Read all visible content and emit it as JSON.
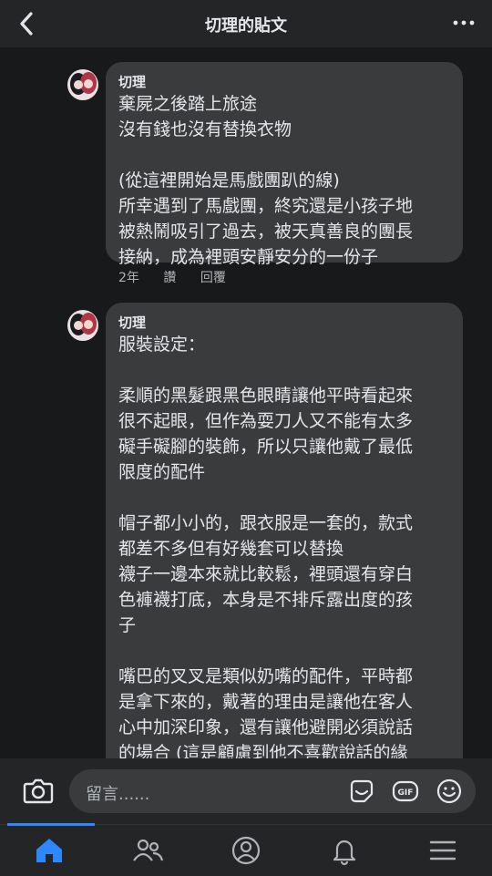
{
  "header": {
    "title": "切理的貼文",
    "back_icon": "chevron-left-icon",
    "more_icon": "more-horizontal-icon"
  },
  "comments": [
    {
      "author": "切理",
      "text": "棄屍之後踏上旅途\n沒有錢也沒有替換衣物\n\n(從這裡開始是馬戲團趴的線)\n所幸遇到了馬戲團，終究還是小孩子地\n被熱鬧吸引了過去，被天真善良的團長\n接納，成為裡頭安靜安分的一份子",
      "time": "2年",
      "like": "讚",
      "reply": "回覆"
    },
    {
      "author": "切理",
      "text": "服裝設定：\n\n柔順的黑髮跟黑色眼睛讓他平時看起來\n很不起眼，但作為耍刀人又不能有太多\n礙手礙腳的裝飾，所以只讓他戴了最低\n限度的配件\n\n帽子都小小的，跟衣服是一套的，款式\n都差不多但有好幾套可以替換\n襪子一邊本來就比較鬆，裡頭還有穿白\n色褲襪打底，本身是不排斥露出度的孩\n子\n\n嘴巴的叉叉是類似奶嘴的配件，平時都\n是拿下來的，戴著的理由是讓他在客人\n心中加深印象，還有讓他避開必須說話\n的場合 (這是顧慮到他不喜歡說話的緣\n故)"
    }
  ],
  "composer": {
    "placeholder": "留言......",
    "camera_icon": "camera-icon",
    "sticker_icon": "sticker-icon",
    "gif_icon": "gif-icon",
    "gif_label": "GIF",
    "emoji_icon": "emoji-icon"
  },
  "bottom_nav": {
    "items": [
      "home-icon",
      "friends-icon",
      "profile-icon",
      "bell-icon",
      "menu-icon"
    ],
    "active": "home-icon",
    "accent": "#2d88ff"
  }
}
